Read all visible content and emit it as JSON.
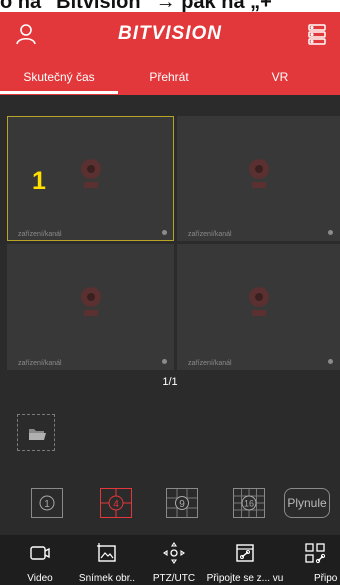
{
  "top_strip_text": "o na \"Bitvision\" → pak  na „+“",
  "header": {
    "brand": "BITVISION",
    "tabs": [
      "Skutečný čas",
      "Přehrát",
      "VR"
    ],
    "active_tab": 0,
    "accent": "#e3383b"
  },
  "channels": [
    {
      "label": "zařízení/kanál",
      "number": "1"
    },
    {
      "label": "zařízení/kanál",
      "number": ""
    },
    {
      "label": "zařízení/kanál",
      "number": ""
    },
    {
      "label": "zařízení/kanál",
      "number": ""
    }
  ],
  "pager": "1/1",
  "layout_options": [
    "1",
    "4",
    "9",
    "16"
  ],
  "smooth_label": "Plynule",
  "bottom_nav": [
    {
      "label": "Video",
      "icon": "video-icon"
    },
    {
      "label": "Snímek obr..",
      "icon": "snapshot-icon"
    },
    {
      "label": "PTZ/UTC",
      "icon": "ptz-icon"
    },
    {
      "label": "Připojte se z... vu",
      "icon": "connect-icon"
    },
    {
      "label": "Připo",
      "icon": "link-icon"
    }
  ]
}
